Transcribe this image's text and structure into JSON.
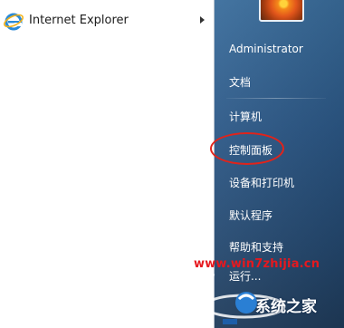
{
  "programs": [
    {
      "label": "Internet Explorer",
      "icon": "internet-explorer-icon",
      "has_submenu": true
    }
  ],
  "right_pane": {
    "user": "Administrator",
    "links": [
      {
        "label": "文档"
      },
      {
        "label": "计算机"
      },
      {
        "label": "控制面板"
      },
      {
        "label": "设备和打印机"
      },
      {
        "label": "默认程序"
      },
      {
        "label": "帮助和支持"
      },
      {
        "label": "运行..."
      }
    ]
  },
  "watermark": {
    "url": "www.win7zhijia.cn",
    "brand": "系统之家"
  },
  "colors": {
    "highlight": "#e2231a",
    "watermark_url": "#e6181e",
    "right_pane": "#2c5887"
  }
}
